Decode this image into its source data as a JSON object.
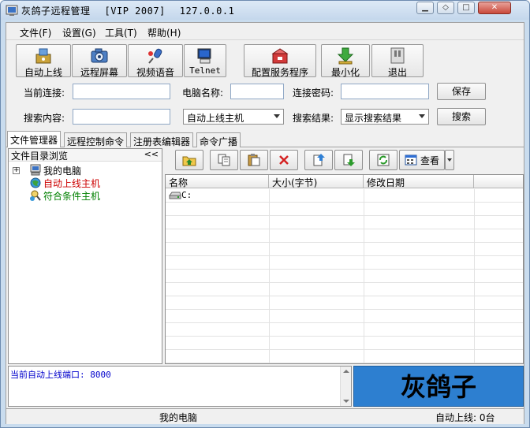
{
  "window": {
    "title": "灰鸽子远程管理",
    "edition": "[VIP 2007]",
    "ip": "127.0.0.1",
    "min_label": "▁",
    "restore_label": "◇",
    "max_label": "□",
    "close_label": "✕"
  },
  "menu": {
    "items": [
      {
        "label": "文件(F)"
      },
      {
        "label": "设置(G)"
      },
      {
        "label": "工具(T)"
      },
      {
        "label": "帮助(H)"
      }
    ]
  },
  "toolbar": {
    "buttons": [
      {
        "label": "自动上线",
        "icon": "auto-online-icon"
      },
      {
        "label": "远程屏幕",
        "icon": "camera-icon"
      },
      {
        "label": "视频语音",
        "icon": "microphone-icon"
      },
      {
        "label": "Telnet",
        "icon": "terminal-icon"
      },
      {
        "label": "配置服务程序",
        "icon": "config-service-icon"
      },
      {
        "label": "最小化",
        "icon": "minimize-arrow-icon"
      },
      {
        "label": "退出",
        "icon": "exit-icon"
      }
    ]
  },
  "connection": {
    "current_label": "当前连接:",
    "current_value": "",
    "computer_name_label": "电脑名称:",
    "computer_name_value": "",
    "password_label": "连接密码:",
    "password_value": "",
    "save_label": "保存"
  },
  "search": {
    "content_label": "搜索内容:",
    "content_value": "",
    "scope_value": "自动上线主机",
    "result_label": "搜索结果:",
    "result_value": "显示搜索结果",
    "search_label": "搜索"
  },
  "tabs": [
    {
      "label": "文件管理器",
      "active": true
    },
    {
      "label": "远程控制命令",
      "active": false
    },
    {
      "label": "注册表编辑器",
      "active": false
    },
    {
      "label": "命令广播",
      "active": false
    }
  ],
  "tree": {
    "header": "文件目录浏览",
    "collapse": "<<",
    "expander": "+",
    "items": [
      {
        "label": "我的电脑",
        "color": "#000000",
        "icon": "computer-icon"
      },
      {
        "label": "自动上线主机",
        "color": "#cc0000",
        "icon": "globe-icon"
      },
      {
        "label": "符合条件主机",
        "color": "#008000",
        "icon": "search-host-icon"
      }
    ]
  },
  "file_toolbar": {
    "view_label": "查看",
    "icons": [
      "up-folder-icon",
      "copy-icon",
      "paste-icon",
      "delete-icon",
      "upload-icon",
      "download-icon",
      "refresh-icon",
      "view-icon"
    ]
  },
  "file_list": {
    "columns": [
      "名称",
      "大小(字节)",
      "修改日期",
      ""
    ],
    "rows": [
      {
        "name": "C:",
        "size": "",
        "date": ""
      }
    ]
  },
  "log": {
    "text": "当前自动上线端口: 8000"
  },
  "banner": {
    "logo_text": "灰鸽子",
    "bg_color": "#2d7fd0"
  },
  "status": {
    "left": "我的电脑",
    "right": "自动上线: 0台"
  }
}
